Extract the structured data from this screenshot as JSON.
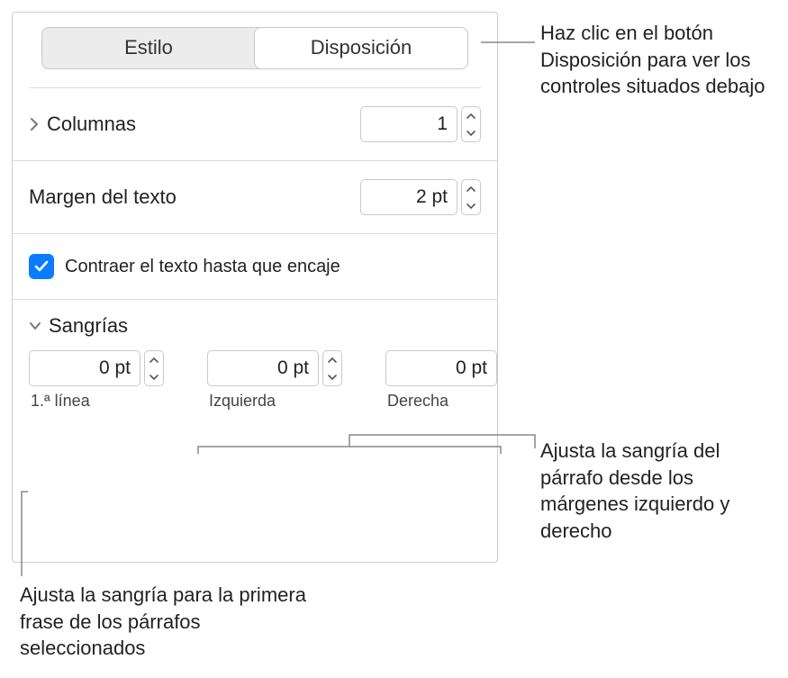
{
  "tabs": {
    "style": "Estilo",
    "layout": "Disposición"
  },
  "columns": {
    "label": "Columnas",
    "value": "1"
  },
  "textMargin": {
    "label": "Margen del texto",
    "value": "2 pt"
  },
  "shrink": {
    "label": "Contraer el texto hasta que encaje",
    "checked": true
  },
  "indents": {
    "header": "Sangrías",
    "firstLine": {
      "value": "0 pt",
      "label": "1.ª línea"
    },
    "left": {
      "value": "0 pt",
      "label": "Izquierda"
    },
    "right": {
      "value": "0 pt",
      "label": "Derecha"
    }
  },
  "callouts": {
    "layoutTab": "Haz clic en el botón Disposición para ver los controles situados debajo",
    "marginsLR": "Ajusta la sangría del párrafo desde los márgenes izquierdo y derecho",
    "firstLine": "Ajusta la sangría para la primera frase de los párrafos seleccionados"
  }
}
